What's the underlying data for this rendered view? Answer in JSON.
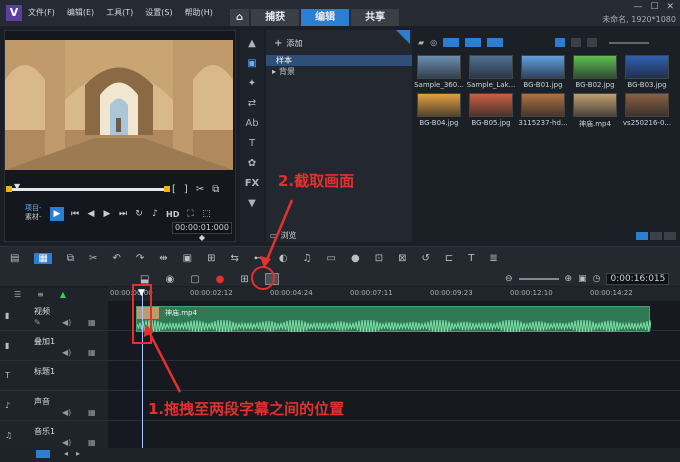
{
  "app": {
    "menu": [
      "文件(F)",
      "编辑(E)",
      "工具(T)",
      "设置(S)",
      "帮助(H)"
    ],
    "tabs": [
      "捕获",
      "编辑",
      "共享"
    ],
    "active_tab": "编辑",
    "project_info": "未命名, 1920*1080"
  },
  "preview": {
    "mode_labels": [
      "项目-",
      "素材-"
    ],
    "hd": "HD",
    "timecode": "00:00:01:000 ◆"
  },
  "library": {
    "add_label": "添加",
    "tree": [
      "样本",
      "背景"
    ],
    "browse_label": "浏览",
    "thumbnails": [
      {
        "label": "Sample_360...",
        "color": "#6d8fb0"
      },
      {
        "label": "Sample_Lak...",
        "color": "#4f6f8f"
      },
      {
        "label": "BG-B01.jpg",
        "color": "#5f9fe0"
      },
      {
        "label": "BG-B02.jpg",
        "color": "#5fbf50"
      },
      {
        "label": "BG-B03.jpg",
        "color": "#2f5fb0"
      },
      {
        "label": "BG-B04.jpg",
        "color": "#e0a040"
      },
      {
        "label": "BG-B05.jpg",
        "color": "#c86040"
      },
      {
        "label": "3115237-hd...",
        "color": "#b07040"
      },
      {
        "label": "神庙.mp4",
        "color": "#c0a070"
      },
      {
        "label": "vs250216-0...",
        "color": "#8a6040"
      }
    ]
  },
  "timeline": {
    "ruler_ticks": [
      "00:00:00:00",
      "00:00:02:12",
      "00:00:04:24",
      "00:00:07:11",
      "00:00:09:23",
      "00:00:12:10",
      "00:00:14:22"
    ],
    "zoom_timecode": "0:00:16:015",
    "tracks": [
      "视频",
      "叠加1",
      "标题1",
      "声音",
      "音乐1"
    ],
    "clip_label": "神庙.mp4"
  },
  "annotations": {
    "capture": "2.截取画面",
    "drag": "1.拖拽至两段字幕之间的位置"
  }
}
